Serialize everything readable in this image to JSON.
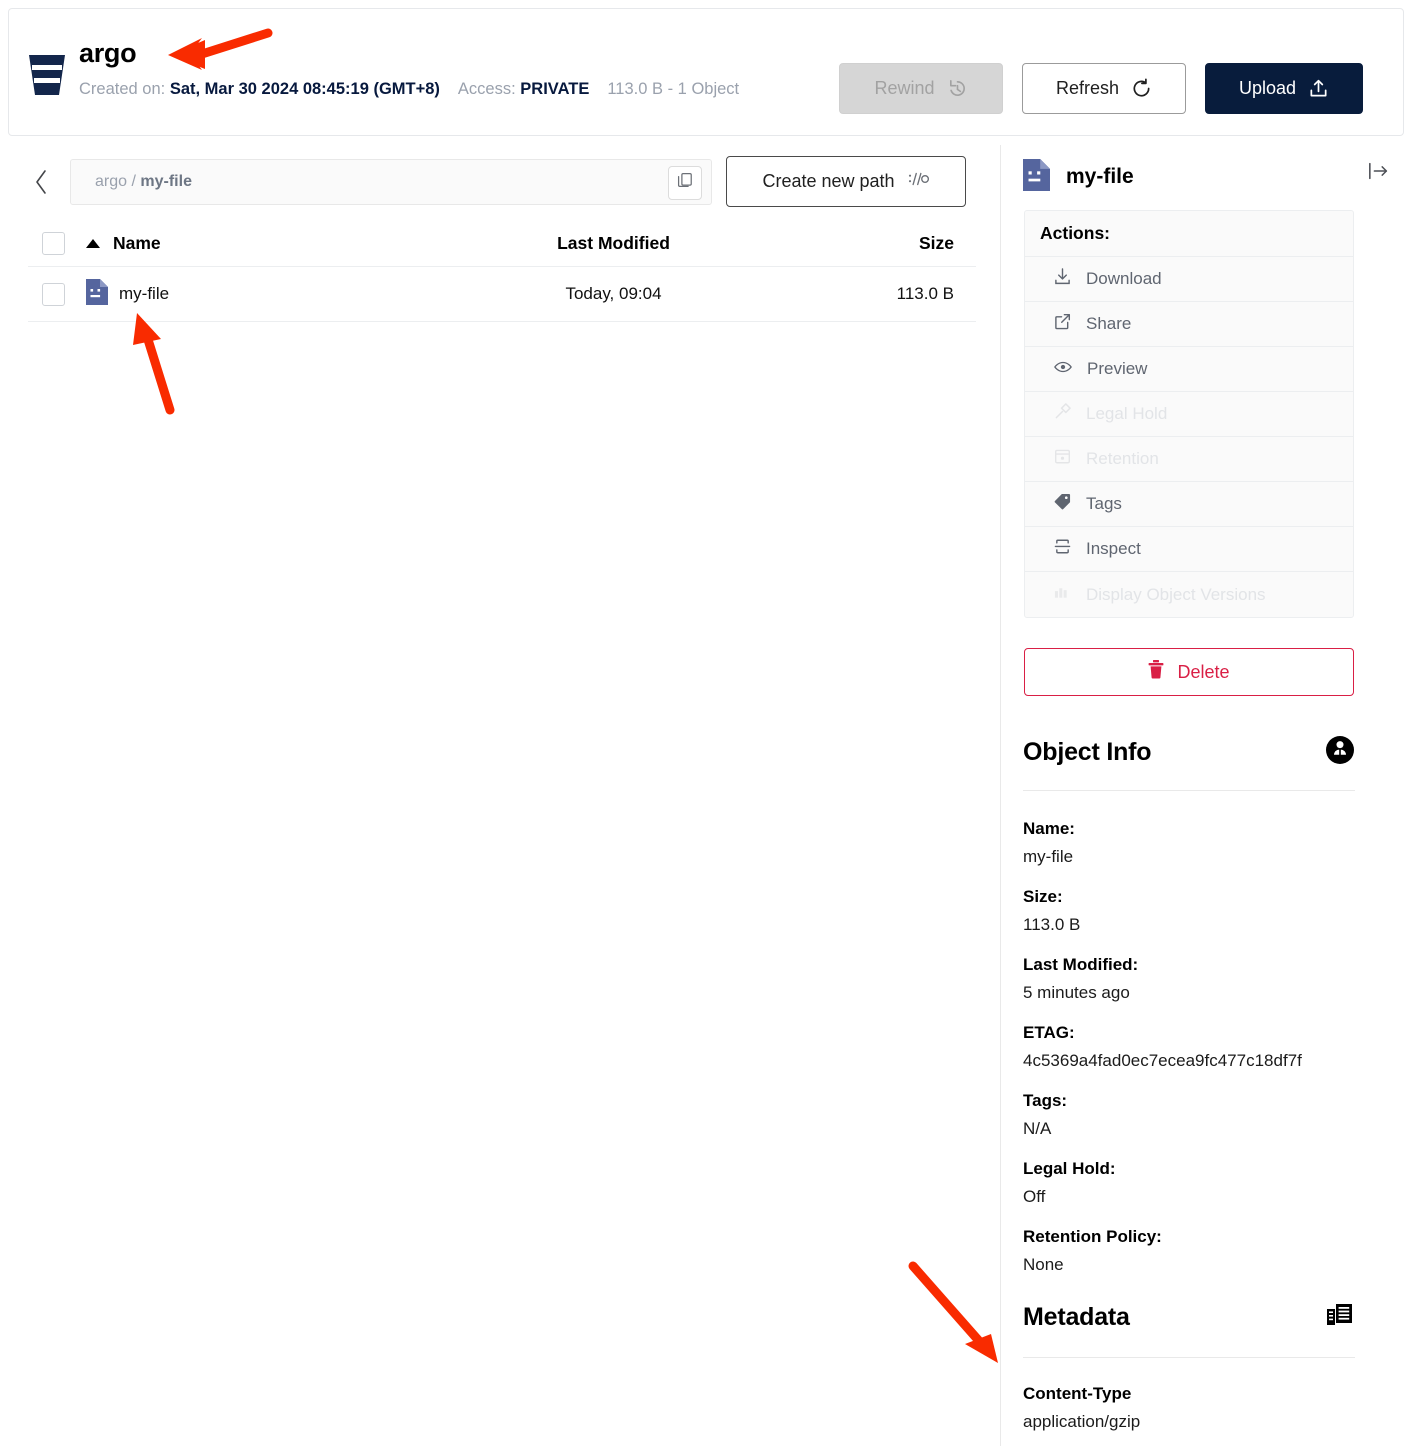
{
  "header": {
    "bucket_icon": "bucket-icon",
    "title": "argo",
    "created_label": "Created on:",
    "created_value": "Sat, Mar 30 2024 08:45:19 (GMT+8)",
    "access_label": "Access:",
    "access_value": "PRIVATE",
    "size_summary": "113.0 B - 1 Object",
    "buttons": {
      "rewind": "Rewind",
      "refresh": "Refresh",
      "upload": "Upload"
    }
  },
  "browser": {
    "breadcrumb": {
      "bucket": "argo",
      "separator": "/",
      "current": "my-file",
      "full": "argo / my-file"
    },
    "create_path_button": "Create new path",
    "columns": {
      "name": "Name",
      "last_modified": "Last Modified",
      "size": "Size"
    },
    "sort": "ascending",
    "rows": [
      {
        "name": "my-file",
        "last_modified": "Today, 09:04",
        "size": "113.0 B",
        "icon": "file-icon"
      }
    ]
  },
  "detail": {
    "title": "my-file",
    "actions_header": "Actions:",
    "actions": [
      {
        "label": "Download",
        "icon": "download-icon",
        "disabled": false
      },
      {
        "label": "Share",
        "icon": "share-icon",
        "disabled": false
      },
      {
        "label": "Preview",
        "icon": "eye-icon",
        "disabled": false
      },
      {
        "label": "Legal Hold",
        "icon": "gavel-icon",
        "disabled": true
      },
      {
        "label": "Retention",
        "icon": "calendar-icon",
        "disabled": true
      },
      {
        "label": "Tags",
        "icon": "tag-icon",
        "disabled": false
      },
      {
        "label": "Inspect",
        "icon": "inspect-icon",
        "disabled": false
      },
      {
        "label": "Display Object Versions",
        "icon": "versions-icon",
        "disabled": true
      }
    ],
    "delete_button": "Delete",
    "object_info": {
      "heading": "Object Info",
      "fields": [
        {
          "key": "Name:",
          "value": "my-file"
        },
        {
          "key": "Size:",
          "value": "113.0 B"
        },
        {
          "key": "Last Modified:",
          "value": "5 minutes ago"
        },
        {
          "key": "ETAG:",
          "value": "4c5369a4fad0ec7ecea9fc477c18df7f"
        },
        {
          "key": "Tags:",
          "value": "N/A"
        },
        {
          "key": "Legal Hold:",
          "value": "Off"
        },
        {
          "key": "Retention Policy:",
          "value": "None"
        }
      ]
    },
    "metadata": {
      "heading": "Metadata",
      "fields": [
        {
          "key": "Content-Type",
          "value": "application/gzip"
        }
      ]
    }
  },
  "colors": {
    "navy": "#081c3c",
    "file_icon": "#55659e",
    "delete_red": "#d91f45",
    "annotation_red": "#f92b00",
    "muted": "#9aa1ad",
    "border": "#e6e8eb"
  }
}
